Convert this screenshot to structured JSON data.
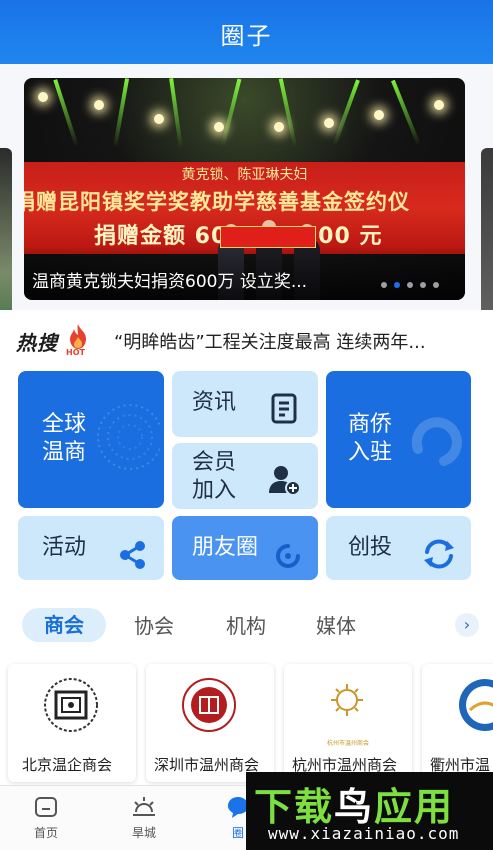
{
  "header": {
    "title": "圈子"
  },
  "banner": {
    "caption": "温商黄克锁夫妇捐资600万 设立奖...",
    "stage_text_names": "黄克锁、陈亚琳夫妇",
    "stage_text_line1": "捐赠昆阳镇奖学奖教助学慈善基金签约仪",
    "stage_text_line2": "捐赠金额 6000000.00 元",
    "dots_total": 5,
    "dot_active_index": 1
  },
  "hot_search": {
    "label": "热搜",
    "badge": "HOT",
    "text": "“明眸皓齿”工程关注度最高 连续两年..."
  },
  "grid": {
    "global": "全球\n温商",
    "news": "资讯",
    "member": "会员\n加入",
    "settle": "商侨\n入驻",
    "activity": "活动",
    "friends": "朋友圈",
    "invest": "创投"
  },
  "tabs": {
    "items": [
      "商会",
      "协会",
      "机构",
      "媒体"
    ],
    "active_index": 0,
    "more_icon": "chevron-right-icon"
  },
  "orgs": [
    {
      "name": "北京温企商会"
    },
    {
      "name": "深圳市温州商会"
    },
    {
      "name": "杭州市温州商会",
      "logo_text": "杭州市温州商会"
    },
    {
      "name": "衢州市温"
    }
  ],
  "bottom_nav": {
    "items": [
      {
        "label": "首页",
        "icon": "home-icon"
      },
      {
        "label": "旱城",
        "icon": "sunrise-icon"
      },
      {
        "label": "圈",
        "icon": "chat-icon"
      }
    ],
    "active_index": 2
  },
  "watermark": {
    "title_a": "下载",
    "title_b": "鸟",
    "title_c": "应用",
    "url": "www.xiazainiao.com"
  },
  "colors": {
    "primary": "#1a73e8",
    "tile_dark": "#1a6ee0",
    "tile_light": "#cde8fa",
    "tile_mid": "#4a93f0",
    "stage_red": "#d72a1d",
    "watermark_green": "#7ee040"
  }
}
